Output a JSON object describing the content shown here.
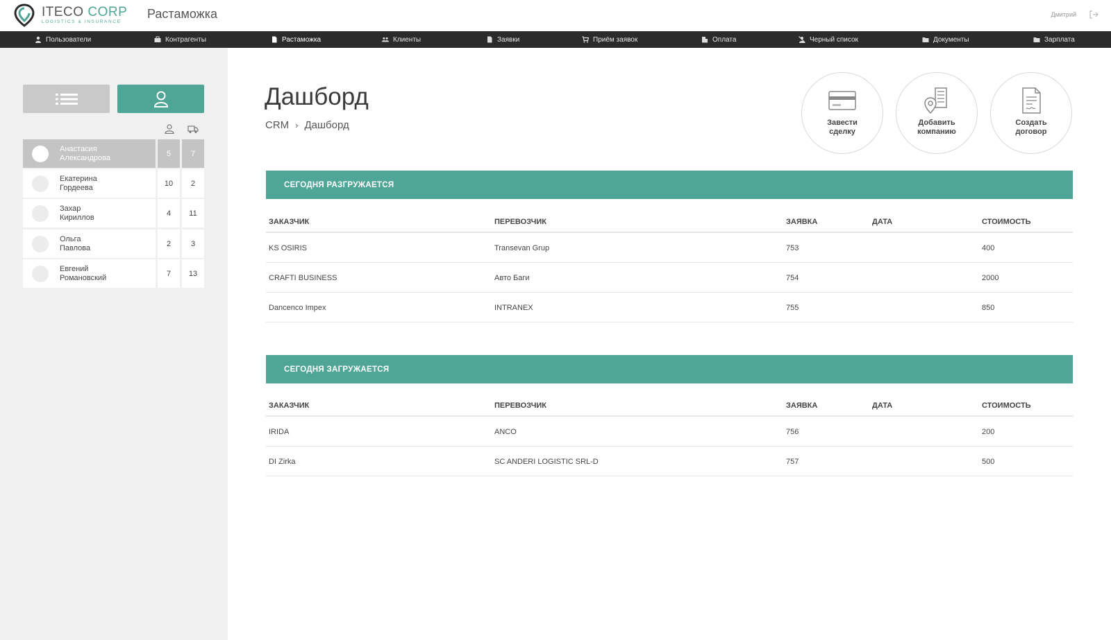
{
  "app": {
    "logo_main": "ITECO",
    "logo_accent": "CORP",
    "logo_sub": "LOGISTICS & INSURANCE",
    "section_title": "Растаможка",
    "user_name": "Дмитрий",
    "accent_color": "#4fa697"
  },
  "nav": [
    {
      "label": "Пользователи",
      "icon": "user-icon"
    },
    {
      "label": "Контрагенты",
      "icon": "briefcase-icon"
    },
    {
      "label": "Растаможка",
      "icon": "document-icon",
      "active": true
    },
    {
      "label": "Клиенты",
      "icon": "users-icon"
    },
    {
      "label": "Заявки",
      "icon": "file-icon"
    },
    {
      "label": "Приём заявок",
      "icon": "cart-icon"
    },
    {
      "label": "Оплата",
      "icon": "bank-icon"
    },
    {
      "label": "Черный список",
      "icon": "blacklist-icon"
    },
    {
      "label": "Документы",
      "icon": "folder-icon"
    },
    {
      "label": "Зарплата",
      "icon": "folder-icon"
    }
  ],
  "sidebar": {
    "employees": [
      {
        "first": "Анастасия",
        "last": "Александрова",
        "clients": "5",
        "trucks": "7",
        "selected": true
      },
      {
        "first": "Екатерина",
        "last": "Гордеева",
        "clients": "10",
        "trucks": "2"
      },
      {
        "first": "Захар",
        "last": "Кириллов",
        "clients": "4",
        "trucks": "11"
      },
      {
        "first": "Ольга",
        "last": "Павлова",
        "clients": "2",
        "trucks": "3"
      },
      {
        "first": "Евгений",
        "last": "Романовский",
        "clients": "7",
        "trucks": "13"
      }
    ]
  },
  "main": {
    "title": "Дашборд",
    "breadcrumb": {
      "root": "CRM",
      "sep": "›",
      "current": "Дашборд"
    },
    "actions": [
      {
        "line1": "Завести",
        "line2": "сделку"
      },
      {
        "line1": "Добавить",
        "line2": "компанию"
      },
      {
        "line1": "Создать",
        "line2": "договор"
      }
    ],
    "columns": [
      "ЗАКАЗЧИК",
      "ПЕРЕВОЗЧИК",
      "ЗАЯВКА",
      "ДАТА",
      "СТОИМОСТЬ"
    ],
    "unloading": {
      "title": "СЕГОДНЯ РАЗГРУЖАЕТСЯ",
      "rows": [
        {
          "customer": "KS OSIRIS",
          "carrier": "Transevan Grup",
          "request": "753",
          "date": "",
          "cost": "400"
        },
        {
          "customer": "CRAFTI BUSINESS",
          "carrier": "Авто Баги",
          "request": "754",
          "date": "",
          "cost": "2000"
        },
        {
          "customer": "Dancenco Impex",
          "carrier": "INTRANEX",
          "request": "755",
          "date": "",
          "cost": "850"
        }
      ]
    },
    "loading": {
      "title": "СЕГОДНЯ ЗАГРУЖАЕТСЯ",
      "rows": [
        {
          "customer": "IRIDA",
          "carrier": "ANCO",
          "request": "756",
          "date": "",
          "cost": "200"
        },
        {
          "customer": "DI Zirka",
          "carrier": "SC ANDERI LOGISTIC SRL-D",
          "request": "757",
          "date": "",
          "cost": "500"
        }
      ]
    }
  }
}
